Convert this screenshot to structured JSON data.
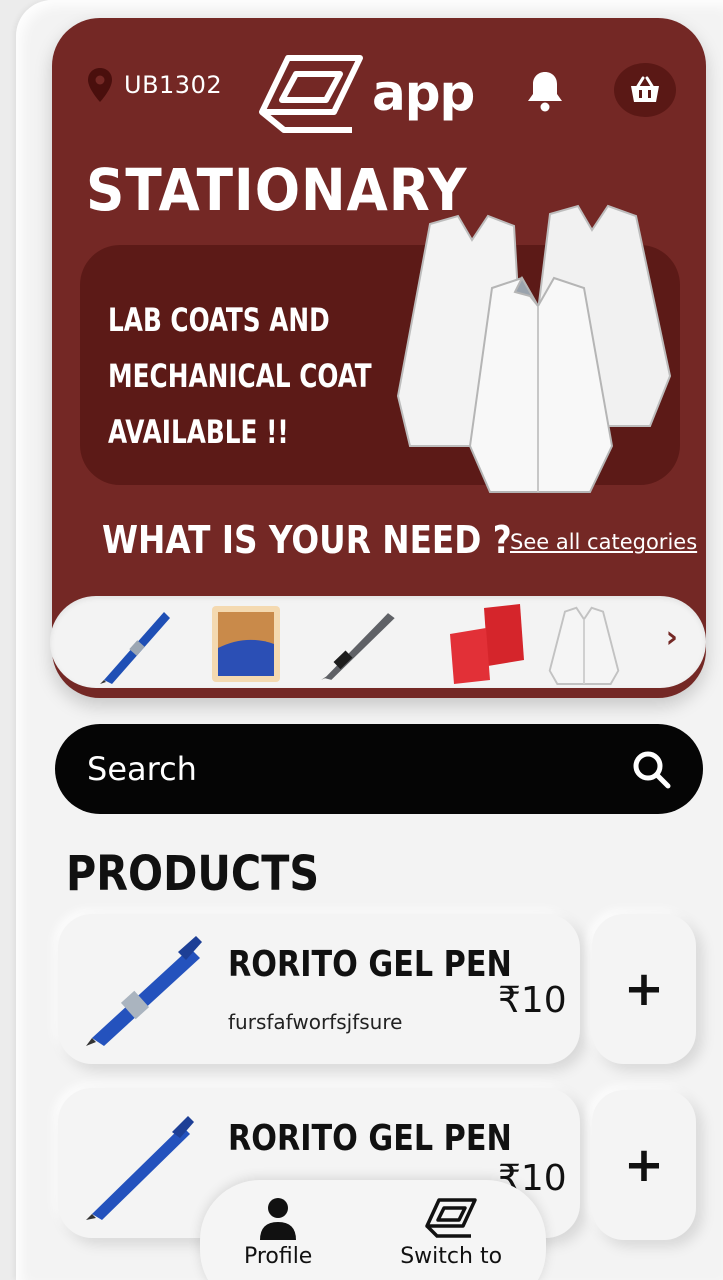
{
  "header": {
    "location_code": "UB1302",
    "logo_text": "app"
  },
  "hero": {
    "title": "STATIONARY",
    "banner_lines": [
      "LAB COATS AND",
      "MECHANICAL COAT",
      "AVAILABLE !!"
    ],
    "need_title": "WHAT IS YOUR NEED ?",
    "see_all": "See all categories"
  },
  "categories": [
    {
      "icon": "blue-pen-icon"
    },
    {
      "icon": "bandage-icon"
    },
    {
      "icon": "black-pen-icon"
    },
    {
      "icon": "red-notebook-icon"
    },
    {
      "icon": "lab-coat-icon"
    }
  ],
  "search": {
    "placeholder": "Search"
  },
  "products": {
    "title": "PRODUCTS",
    "items": [
      {
        "name": "RORITO GEL PEN",
        "description": "fursfafworfsjfsure",
        "price": "₹10",
        "add": "+"
      },
      {
        "name": "RORITO GEL PEN",
        "description": "",
        "price": "₹10",
        "add": "+"
      }
    ]
  },
  "nav": {
    "profile": "Profile",
    "switch": "Switch to"
  },
  "colors": {
    "brand": "#742825",
    "banner": "#5c1a17",
    "search_bg": "#050505"
  }
}
